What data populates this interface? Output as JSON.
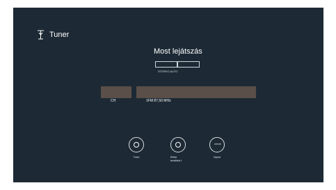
{
  "screen": {
    "title": {
      "icon": "antenna-icon",
      "label": "Tuner"
    },
    "now_playing": "Most lejátszás",
    "stereo_status": "STEREO AUTO",
    "channel_label": "CH",
    "frequency": "1FM 87,50 MHz",
    "controls": [
      {
        "icon": "tune-dial-icon",
        "label": "Tune"
      },
      {
        "icon": "preset-dial-icon",
        "label": "Előre beállítot t"
      },
      {
        "icon": "option-icon",
        "icon_text": "OPCIÓ",
        "label": "Opció"
      }
    ]
  },
  "colors": {
    "background": "#1d2a35",
    "text": "#ffffff",
    "band": "#5a4f49"
  }
}
